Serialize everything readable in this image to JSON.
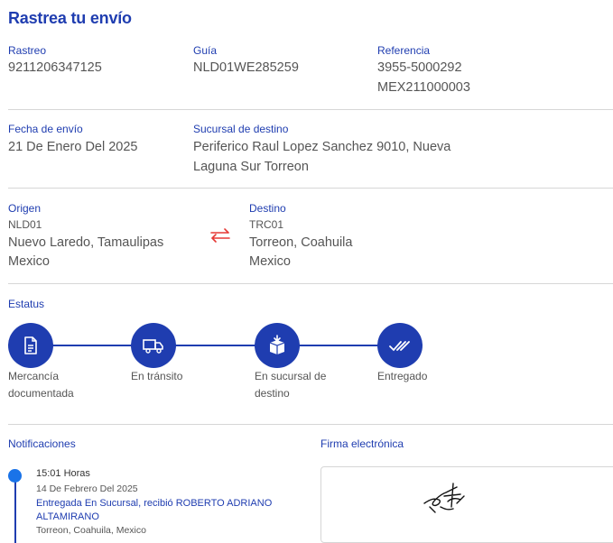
{
  "page": {
    "title": "Rastrea tu envío"
  },
  "details": {
    "rastreo_label": "Rastreo",
    "rastreo_value": "9211206347125",
    "guia_label": "Guía",
    "guia_value": "NLD01WE285259",
    "referencia_label": "Referencia",
    "referencia_line1": "3955-5000292",
    "referencia_line2": "MEX211000003",
    "fecha_label": "Fecha de envío",
    "fecha_value": "21 De Enero Del 2025",
    "sucursal_label": "Sucursal de destino",
    "sucursal_line1": "Periferico Raul Lopez Sanchez 9010, Nueva",
    "sucursal_line2": "Laguna Sur Torreon"
  },
  "route": {
    "origen_label": "Origen",
    "origen_code": "NLD01",
    "origen_city": "Nuevo Laredo, Tamaulipas",
    "origen_country": "Mexico",
    "swap_icon": "swap-arrows-icon",
    "destino_label": "Destino",
    "destino_code": "TRC01",
    "destino_city": "Torreon, Coahuila",
    "destino_country": "Mexico"
  },
  "status": {
    "label": "Estatus",
    "steps": [
      {
        "line1": "Mercancía",
        "line2": "documentada",
        "icon": "document-icon"
      },
      {
        "line1": "En tránsito",
        "line2": "",
        "icon": "truck-icon"
      },
      {
        "line1": "En sucursal de",
        "line2": "destino",
        "icon": "package-icon"
      },
      {
        "line1": "Entregado",
        "line2": "",
        "icon": "double-check-icon"
      }
    ],
    "accent_color": "#1f3db0"
  },
  "notifications": {
    "label": "Notificaciones",
    "items": [
      {
        "time": "15:01 Horas",
        "date": "14 De Febrero Del 2025",
        "status_line1": "Entregada En Sucursal, recibió ROBERTO ADRIANO",
        "status_line2": "ALTAMIRANO",
        "place": "Torreon, Coahuila, Mexico"
      }
    ],
    "dot_color": "#1a73e8"
  },
  "signature": {
    "label": "Firma electrónica"
  }
}
